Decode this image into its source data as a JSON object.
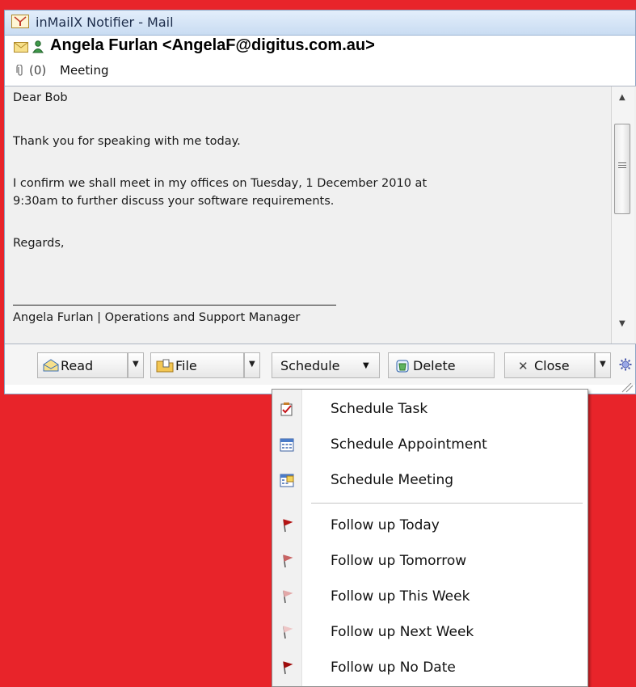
{
  "window": {
    "title": "inMailX Notifier - Mail"
  },
  "message": {
    "from": "Angela Furlan <AngelaF@digitus.com.au>",
    "attachments": "(0)",
    "subject": "Meeting",
    "body": [
      "Dear Bob",
      "Thank you for speaking with me today.",
      "I confirm we shall meet in my offices on Tuesday, 1 December 2010 at",
      "9:30am to further discuss your software requirements.",
      "Regards,",
      "Angela Furlan | Operations and Support Manager"
    ]
  },
  "toolbar": {
    "read": "Read",
    "file": "File",
    "schedule": "Schedule",
    "delete": "Delete",
    "close": "Close"
  },
  "menu": {
    "items": [
      {
        "label": "Schedule Task",
        "icon": "task-icon"
      },
      {
        "label": "Schedule Appointment",
        "icon": "calendar-icon"
      },
      {
        "label": "Schedule Meeting",
        "icon": "meeting-icon"
      },
      {
        "label": "Follow up Today",
        "icon": "flag-icon",
        "color": "#b41414"
      },
      {
        "label": "Follow up Tomorrow",
        "icon": "flag-icon",
        "color": "#c86464"
      },
      {
        "label": "Follow up This Week",
        "icon": "flag-icon",
        "color": "#e3a8a8"
      },
      {
        "label": "Follow up Next Week",
        "icon": "flag-icon",
        "color": "#eec6c6"
      },
      {
        "label": "Follow up No Date",
        "icon": "flag-icon",
        "color": "#a00c0c"
      }
    ]
  },
  "colors": {
    "background": "#e8242a",
    "titlebar": "#c9dcf2",
    "body": "#f0f0f0"
  }
}
